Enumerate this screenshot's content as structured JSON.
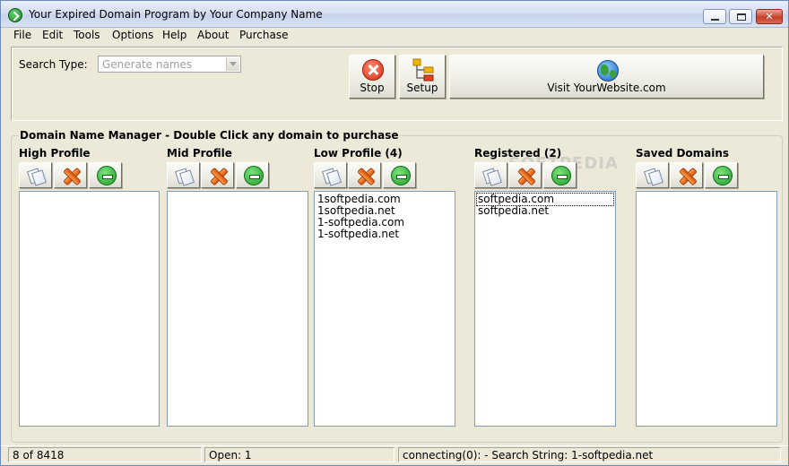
{
  "window": {
    "title": "Your Expired Domain Program by Your Company Name"
  },
  "menu": [
    "File",
    "Edit",
    "Tools",
    "Options",
    "Help",
    "About",
    "Purchase"
  ],
  "search": {
    "label": "Search Type:",
    "value": "Generate names"
  },
  "toolbar": {
    "stop_label": "Stop",
    "setup_label": "Setup",
    "visit_label": "Visit YourWebsite.com"
  },
  "manager": {
    "title": "Domain Name Manager - Double Click any domain to purchase",
    "columns": [
      {
        "label": "High Profile",
        "items": []
      },
      {
        "label": "Mid Profile",
        "items": []
      },
      {
        "label": "Low Profile (4)",
        "items": [
          "1softpedia.com",
          "1softpedia.net",
          "1-softpedia.com",
          "1-softpedia.net"
        ]
      },
      {
        "label": "Registered (2)",
        "items": [
          "softpedia.com",
          "softpedia.net"
        ]
      },
      {
        "label": "Saved Domains",
        "items": []
      }
    ]
  },
  "watermark": "SOFTPEDIA",
  "status": {
    "count": "8 of 8418",
    "open": "Open: 1",
    "message": "connecting(0): - Search String: 1-softpedia.net"
  },
  "colors": {
    "window_bg": "#ece9d8",
    "list_border": "#7f9db9"
  }
}
